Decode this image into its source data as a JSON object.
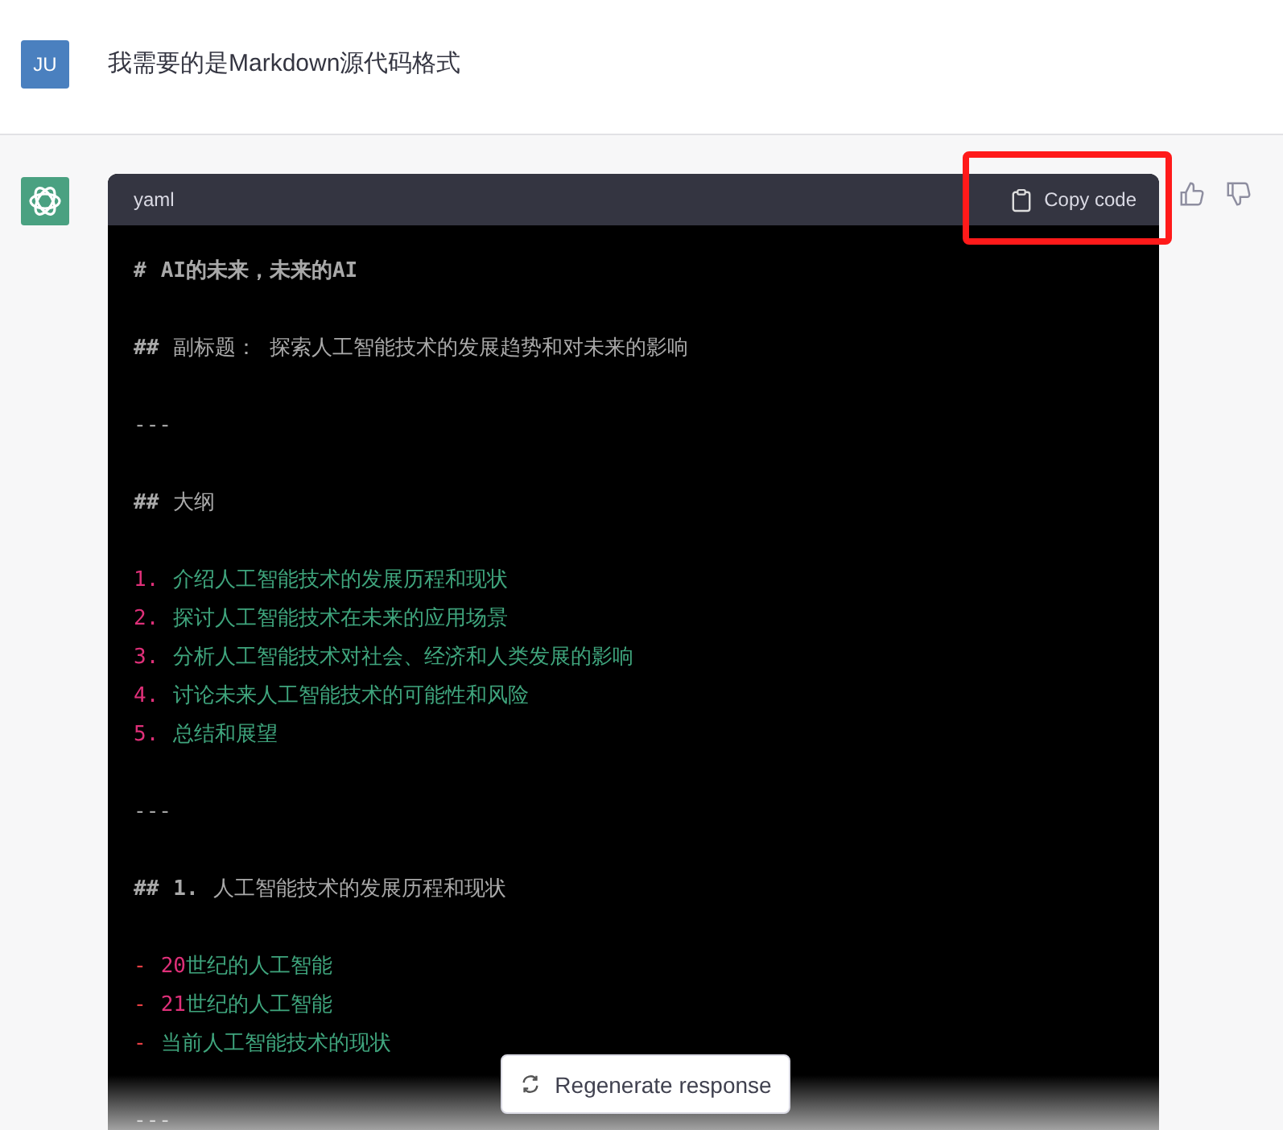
{
  "user_message": {
    "avatar": "JU",
    "text": "我需要的是Markdown源代码格式"
  },
  "assistant_message": {
    "code_block": {
      "language": "yaml",
      "copy_button": "Copy code",
      "highlighted": true,
      "lines": [
        {
          "kind": "heading",
          "marker": "#",
          "text": "AI的未来，未来的AI",
          "bold": true
        },
        {
          "kind": "blank"
        },
        {
          "kind": "heading",
          "marker": "##",
          "text": "副标题： 探索人工智能技术的发展趋势和对未来的影响",
          "bold": false
        },
        {
          "kind": "blank"
        },
        {
          "kind": "rule",
          "text": "---"
        },
        {
          "kind": "blank"
        },
        {
          "kind": "heading",
          "marker": "##",
          "text": "大纲",
          "bold": false
        },
        {
          "kind": "blank"
        },
        {
          "kind": "ordered",
          "marker": "1.",
          "text": "介绍人工智能技术的发展历程和现状"
        },
        {
          "kind": "ordered",
          "marker": "2.",
          "text": "探讨人工智能技术在未来的应用场景"
        },
        {
          "kind": "ordered",
          "marker": "3.",
          "text": "分析人工智能技术对社会、经济和人类发展的影响"
        },
        {
          "kind": "ordered",
          "marker": "4.",
          "text": "讨论未来人工智能技术的可能性和风险"
        },
        {
          "kind": "ordered",
          "marker": "5.",
          "text": "总结和展望"
        },
        {
          "kind": "blank"
        },
        {
          "kind": "rule",
          "text": "---"
        },
        {
          "kind": "blank"
        },
        {
          "kind": "heading",
          "marker": "##",
          "number": "1.",
          "text": "人工智能技术的发展历程和现状",
          "bold": false
        },
        {
          "kind": "blank"
        },
        {
          "kind": "bullet",
          "marker": "-",
          "number": "20",
          "text": "世纪的人工智能"
        },
        {
          "kind": "bullet",
          "marker": "-",
          "number": "21",
          "text": "世纪的人工智能"
        },
        {
          "kind": "bullet",
          "marker": "-",
          "text": "当前人工智能技术的现状"
        },
        {
          "kind": "blank"
        },
        {
          "kind": "rule",
          "text": "---"
        }
      ]
    }
  },
  "regenerate_button": "Regenerate response"
}
